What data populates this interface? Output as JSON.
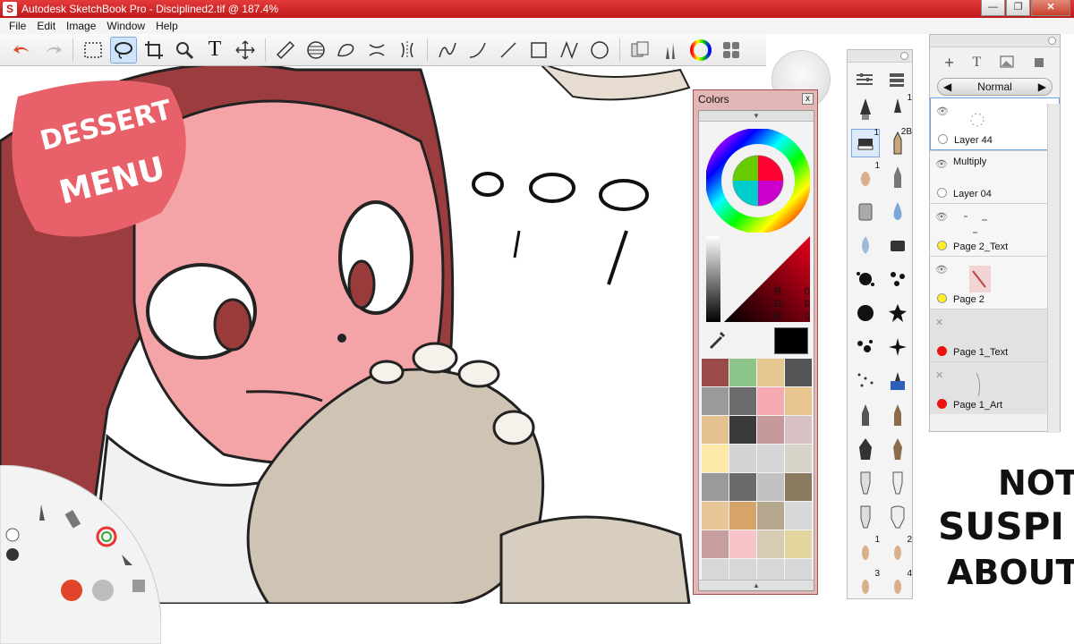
{
  "window": {
    "title": "Autodesk SketchBook Pro - Disciplined2.tif @ 187.4%",
    "app_icon_letter": "S"
  },
  "menubar": {
    "items": [
      "File",
      "Edit",
      "Image",
      "Window",
      "Help"
    ]
  },
  "window_controls": {
    "minimize": "—",
    "restore": "❐",
    "close": "✕"
  },
  "toolbar": {
    "tools": [
      "undo-icon",
      "redo-icon",
      "rect-select-icon",
      "lasso-icon",
      "crop-icon",
      "zoom-icon",
      "text-icon",
      "transform-icon",
      "ruler-icon",
      "ellipse-guide-icon",
      "french-curve-icon",
      "symmetry-x-icon",
      "symmetry-y-icon",
      "stroke-icon",
      "curve-icon",
      "line-icon",
      "rectangle-icon",
      "polyline-icon",
      "circle-icon",
      "copy-paste-icon",
      "brush-library-icon",
      "color-wheel-icon",
      "palette-icon"
    ],
    "selected": "lasso-icon",
    "text_tool_glyph": "T"
  },
  "colors_panel": {
    "title": "Colors",
    "close_glyph": "x",
    "rgb": {
      "r_label": "R:",
      "g_label": "G:",
      "b_label": "B:",
      "r": "0",
      "g": "0",
      "b": "0"
    },
    "current_color": "#000000",
    "swatches": [
      "#9b4a4a",
      "#8cc48a",
      "#e6c78f",
      "#555555",
      "#9a9a9a",
      "#6b6b6b",
      "#f4aab0",
      "#e8c48e",
      "#e6c190",
      "#3a3a3a",
      "#c69a9a",
      "#d8c1c3",
      "#fdeaa8",
      "#d4d4d4",
      "#d6d6d6",
      "#d9d4c9",
      "#9a9a9a",
      "#6a6a6a",
      "#c2c2c2",
      "#8a7a60",
      "#e7c597",
      "#d7a468",
      "#b5a68e",
      "#d8d8d8",
      "#c79d9d",
      "#f8c4ca",
      "#d6ccb4",
      "#e3d59e",
      "#d7d7d7",
      "#d7d7d7",
      "#d7d7d7",
      "#d7d7d7"
    ]
  },
  "brush_palette": {
    "labels": {
      "b1": "1",
      "b2": "1",
      "b3": "2B",
      "b4": "1",
      "b5": "1",
      "b6": "2",
      "b7": "3",
      "b8": "4"
    }
  },
  "layers_panel": {
    "blend_mode": "Normal",
    "layers": [
      {
        "name": "Layer 44",
        "mode": "",
        "badge": "#ffffff",
        "selected": true
      },
      {
        "name": "Layer 04",
        "mode": "Multiply",
        "badge": "#ffffff",
        "selected": false
      },
      {
        "name": "Page 2_Text",
        "mode": "",
        "badge": "#ffee22",
        "selected": false
      },
      {
        "name": "Page 2",
        "mode": "",
        "badge": "#ffee22",
        "selected": false
      },
      {
        "name": "Page 1_Text",
        "mode": "",
        "badge": "#ee1111",
        "selected": false
      },
      {
        "name": "Page 1_Art",
        "mode": "",
        "badge": "#ee1111",
        "selected": false
      }
    ]
  },
  "canvas": {
    "sign_line1": "DESSERT",
    "sign_line2": "MENU",
    "right_text_1": "NOT",
    "right_text_2": "SUSPI",
    "right_text_3": "ABOUT"
  }
}
